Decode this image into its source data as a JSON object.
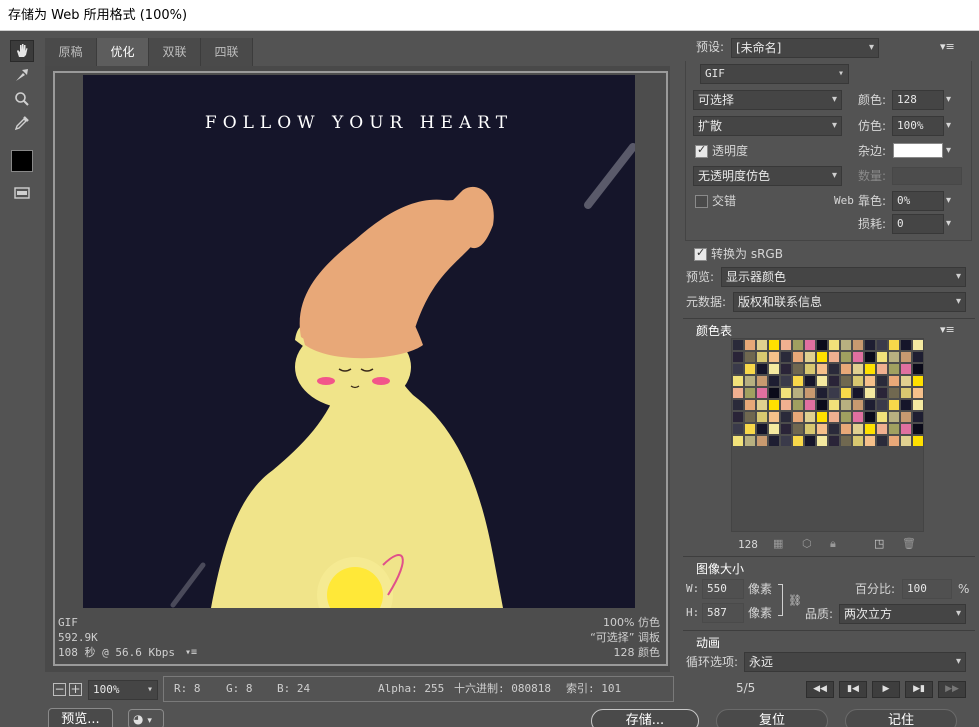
{
  "window": {
    "title": "存储为 Web 所用格式 (100%)"
  },
  "tabs": [
    "原稿",
    "优化",
    "双联",
    "四联"
  ],
  "artwork": {
    "headline": "FOLLOW YOUR HEART"
  },
  "image_info": {
    "format": "GIF",
    "size": "592.9K",
    "download": "108 秒 @ 56.6 Kbps",
    "quality": "100% 仿色",
    "palette": "“可选择” 调板",
    "colors": "128 颜色"
  },
  "statusbar": {
    "zoom": "100%",
    "r": "R: 8",
    "g": "G: 8",
    "b": "B: 24",
    "alpha": "Alpha: 255",
    "hex": "十六进制: 080818",
    "index": "索引: 101"
  },
  "settings": {
    "preset_label": "预设:",
    "preset_value": "[未命名]",
    "format": "GIF",
    "reduction": "可选择",
    "dither_algo": "扩散",
    "transparency_label": "透明度",
    "transparency_dither": "无透明度仿色",
    "interlaced_label": "交错",
    "colors_label": "颜色:",
    "colors_value": "128",
    "dither_label": "仿色:",
    "dither_value": "100%",
    "matte_label": "杂边:",
    "amount_label": "数量:",
    "web_label": "Web",
    "web_snap_label": "靠色:",
    "web_snap_value": "0%",
    "lossy_label": "损耗:",
    "lossy_value": "0",
    "convert_srgb": "转换为 sRGB",
    "preview_label": "预览:",
    "preview_value": "显示器颜色",
    "metadata_label": "元数据:",
    "metadata_value": "版权和联系信息"
  },
  "color_table": {
    "title": "颜色表",
    "count": "128"
  },
  "image_size": {
    "title": "图像大小",
    "w_label": "W:",
    "w_value": "550",
    "h_label": "H:",
    "h_value": "587",
    "unit": "像素",
    "percent_label": "百分比:",
    "percent_value": "100",
    "percent_unit": "%",
    "quality_label": "品质:",
    "quality_value": "两次立方"
  },
  "animation": {
    "title": "动画",
    "loop_label": "循环选项:",
    "loop_value": "永远",
    "frame": "5/5"
  },
  "buttons": {
    "preview": "预览...",
    "save": "存储...",
    "reset": "复位",
    "remember": "记住"
  },
  "colors": {
    "accent": "#ffffff",
    "background": "#535353",
    "artwork_bg": "#15152a",
    "hair": "#e8a878",
    "skin": "#f0e48a"
  }
}
